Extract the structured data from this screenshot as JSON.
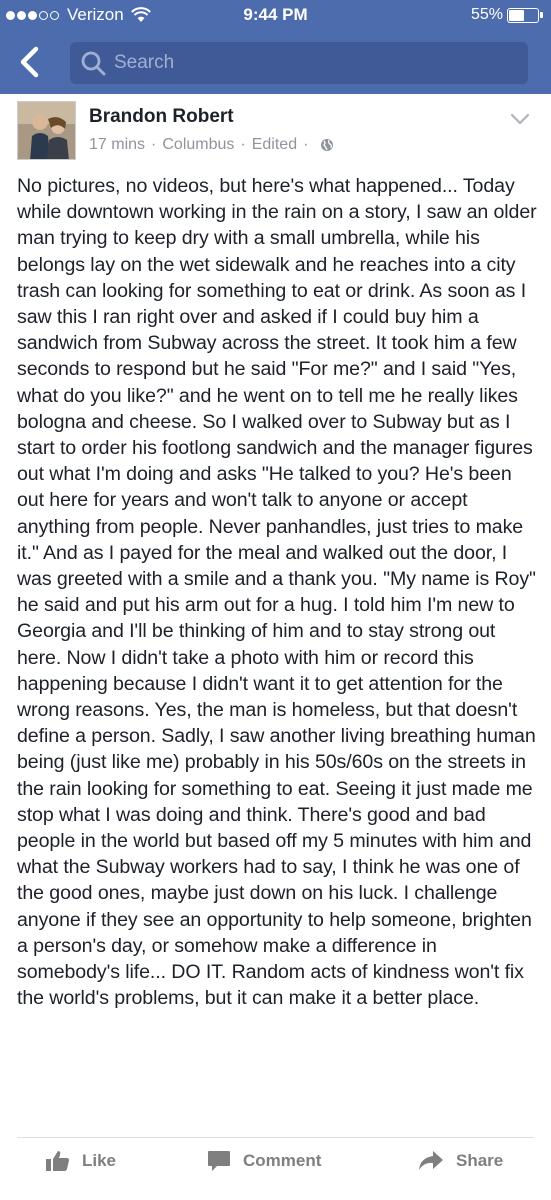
{
  "status_bar": {
    "carrier": "Verizon",
    "time": "9:44 PM",
    "battery": "55%",
    "battery_level": 0.55
  },
  "nav": {
    "search_placeholder": "Search"
  },
  "post": {
    "author": "Brandon Robert",
    "time_ago": "17 mins",
    "location": "Columbus",
    "edited": "Edited",
    "body": "No pictures, no videos, but here's what happened... Today while downtown working in the rain on a story, I saw an older man trying to keep dry with a small umbrella, while his belongs lay on the wet sidewalk and he reaches into a city trash can looking for something to eat or drink. As soon as I saw this I ran right over and asked if I could buy him a sandwich from Subway across the street. It took him a few seconds to respond but he said \"For me?\" and I said \"Yes, what do you like?\" and he went on to tell me he really likes bologna and cheese. So I walked over to Subway but as I start to order his footlong sandwich and the manager figures out what I'm doing and asks \"He talked to you? He's been out here for years and won't talk to anyone or accept anything from people. Never panhandles, just tries to make it.\" And as I payed for the meal and walked out the door, I was greeted with a smile and a thank you. \"My name is Roy\" he said and put his arm out for a hug. I told him I'm new to Georgia and I'll be thinking of him and to stay strong out here. Now I didn't take a photo with him or record this happening because I didn't want it to get attention for the wrong reasons. Yes, the man is homeless, but that doesn't define a person. Sadly, I saw another living breathing human being (just like me) probably in his 50s/60s on the streets in the rain looking for something to eat. Seeing it just made me stop what I was doing and think. There's good and bad people in the world but based off my 5 minutes with him and what the Subway workers had to say, I think he was one of the good ones, maybe just down on his luck. I challenge anyone if they see an opportunity to help someone, brighten a person's day, or somehow make a difference in somebody's life... DO IT. Random acts of kindness won't fix the world's problems, but it can make it a better place."
  },
  "actions": {
    "like": "Like",
    "comment": "Comment",
    "share": "Share"
  },
  "icons": {
    "back": "back-arrow-icon",
    "search": "search-icon",
    "globe": "globe-icon",
    "options": "chevron-down-icon",
    "like": "thumbs-up-icon",
    "comment": "comment-bubble-icon",
    "share": "share-arrow-icon"
  },
  "colors": {
    "nav_bar": "#4d6cad",
    "search_box": "#3f5a96",
    "meta_text": "#90949c",
    "action_text": "#7f7f7f"
  }
}
